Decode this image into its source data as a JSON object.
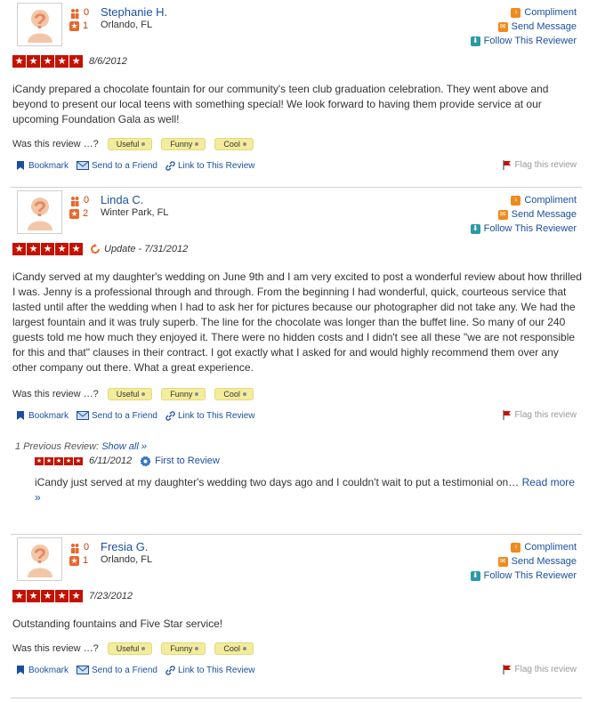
{
  "reviews": [
    {
      "user_name": "Stephanie H.",
      "location": "Orlando, FL",
      "friends_count": "0",
      "reviews_count": "1",
      "date": "8/6/2012",
      "update_label": "",
      "rating": 5,
      "text": "iCandy prepared a chocolate fountain for our community's teen club graduation celebration.  They went above and beyond to present our local teens with something special!  We look forward to having them provide service at our upcoming Foundation Gala as well!"
    },
    {
      "user_name": "Linda C.",
      "location": "Winter Park, FL",
      "friends_count": "0",
      "reviews_count": "2",
      "date": "Update - 7/31/2012",
      "rating": 5,
      "text": "iCandy served at my daughter's wedding on June 9th and I am very excited to post a wonderful review about how thrilled I was.  Jenny is a professional through and through.  From the beginning I had wonderful, quick, courteous service that lasted until after the wedding when I had to ask her for pictures because our photographer did not take any.  We had the largest fountain and it was truly superb.  The line for the chocolate was longer than the buffet line.  So many of our 240 guests told me how much they enjoyed it.  There were no hidden costs and I didn't see all these \"we are not responsible for this and that\" clauses in their contract.  I got exactly what I asked for and would highly recommend them over any other company out there.  What a great experience.",
      "previous": {
        "label": "1 Previous Review:",
        "show_all": "Show all »",
        "date": "6/11/2012",
        "badge": "First to Review",
        "rating": 5,
        "text": "iCandy just served at my daughter's wedding two days ago and I couldn't wait to put a testimonial on… ",
        "read_more": "Read more »"
      }
    },
    {
      "user_name": "Fresia G.",
      "location": "Orlando, FL",
      "friends_count": "0",
      "reviews_count": "1",
      "date": "7/23/2012",
      "rating": 5,
      "text": "Outstanding fountains and Five Star service!"
    }
  ],
  "ui": {
    "compliment": "Compliment",
    "send_message": "Send Message",
    "follow": "Follow This Reviewer",
    "vote_question": "Was this review …?",
    "useful": "Useful",
    "funny": "Funny",
    "cool": "Cool",
    "bookmark": "Bookmark",
    "send_friend": "Send to a Friend",
    "link_review": "Link to This Review",
    "flag": "Flag this review",
    "star_glyph": "★"
  },
  "colors": {
    "link": "#1a4f9f",
    "star_red": "#c41200",
    "vote_yellow": "#f3ec9c"
  }
}
